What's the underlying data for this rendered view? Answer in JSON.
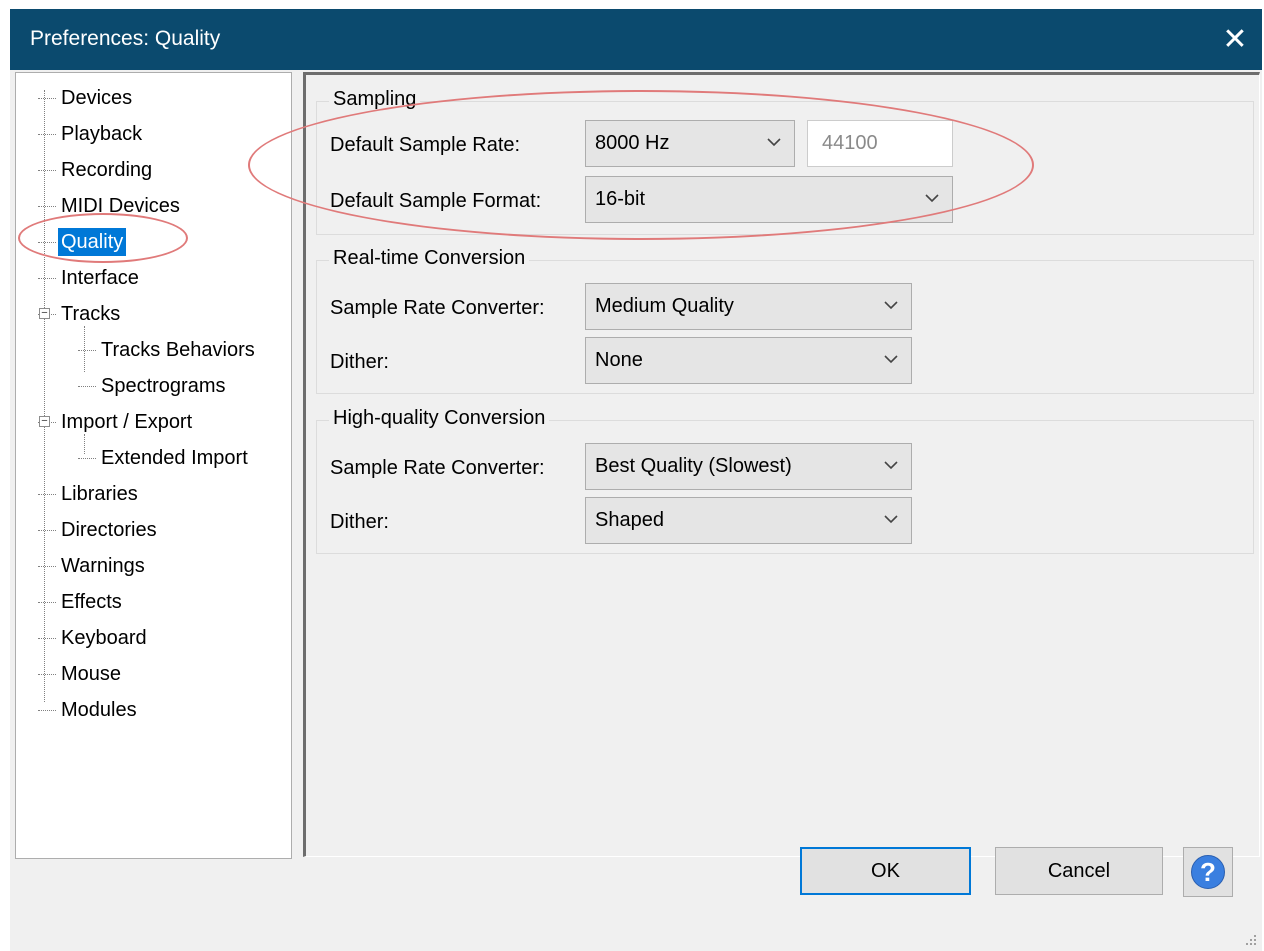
{
  "window": {
    "title": "Preferences: Quality",
    "close_glyph": "✕"
  },
  "tree": [
    {
      "label": "Devices"
    },
    {
      "label": "Playback"
    },
    {
      "label": "Recording"
    },
    {
      "label": "MIDI Devices"
    },
    {
      "label": "Quality",
      "selected": true
    },
    {
      "label": "Interface"
    },
    {
      "label": "Tracks",
      "expander": "−"
    },
    {
      "label": "Tracks Behaviors"
    },
    {
      "label": "Spectrograms"
    },
    {
      "label": "Import / Export",
      "expander": "−"
    },
    {
      "label": "Extended Import"
    },
    {
      "label": "Libraries"
    },
    {
      "label": "Directories"
    },
    {
      "label": "Warnings"
    },
    {
      "label": "Effects"
    },
    {
      "label": "Keyboard"
    },
    {
      "label": "Mouse"
    },
    {
      "label": "Modules"
    }
  ],
  "sampling": {
    "title": "Sampling",
    "rate_label": "Default Sample Rate:",
    "rate_value": "8000 Hz",
    "rate_custom": "44100",
    "format_label": "Default Sample Format:",
    "format_value": "16-bit"
  },
  "realtime": {
    "title": "Real-time Conversion",
    "converter_label": "Sample Rate Converter:",
    "converter_value": "Medium Quality",
    "dither_label": "Dither:",
    "dither_value": "None"
  },
  "highquality": {
    "title": "High-quality Conversion",
    "converter_label": "Sample Rate Converter:",
    "converter_value": "Best Quality (Slowest)",
    "dither_label": "Dither:",
    "dither_value": "Shaped"
  },
  "buttons": {
    "ok": "OK",
    "cancel": "Cancel",
    "help": "?"
  },
  "colors": {
    "titlebar": "#0b4a6e",
    "selection": "#0078d7",
    "annotation": "#e07a7a"
  }
}
